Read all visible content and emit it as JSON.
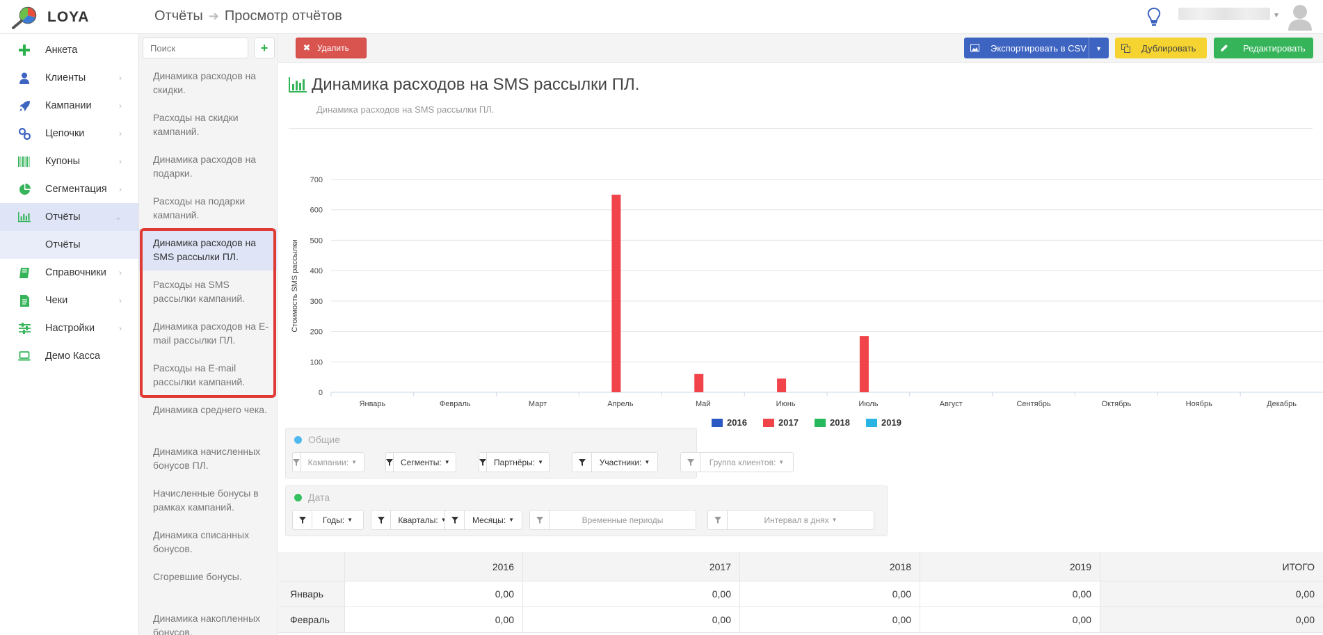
{
  "app": {
    "name": "LOYA"
  },
  "breadcrumb": {
    "root": "Отчёты",
    "current": "Просмотр отчётов"
  },
  "sidebar": {
    "items": [
      {
        "label": "Анкета",
        "icon": "plus-icon",
        "chevron": false
      },
      {
        "label": "Клиенты",
        "icon": "user-icon",
        "chevron": true
      },
      {
        "label": "Кампании",
        "icon": "rocket-icon",
        "chevron": true
      },
      {
        "label": "Цепочки",
        "icon": "link-icon",
        "chevron": true
      },
      {
        "label": "Купоны",
        "icon": "barcode-icon",
        "chevron": true
      },
      {
        "label": "Сегментация",
        "icon": "pie-chart-icon",
        "chevron": true
      },
      {
        "label": "Отчёты",
        "icon": "bar-chart-icon",
        "chevron": true,
        "active": true
      },
      {
        "label": "Справочники",
        "icon": "book-icon",
        "chevron": true
      },
      {
        "label": "Чеки",
        "icon": "receipt-icon",
        "chevron": true
      },
      {
        "label": "Настройки",
        "icon": "sliders-icon",
        "chevron": true
      },
      {
        "label": "Демо Касса",
        "icon": "laptop-icon",
        "chevron": false
      }
    ],
    "sub_item": "Отчёты"
  },
  "list": {
    "search_placeholder": "Поиск",
    "add_label": "+",
    "reports": [
      "Динамика расходов на скидки.",
      "Расходы на скидки кампаний.",
      "Динамика расходов на подарки.",
      "Расходы на подарки кампаний.",
      "Динамика расходов на SMS рассылки ПЛ.",
      "Расходы на SMS рассылки кампаний.",
      "Динамика расходов на E-mail рассылки ПЛ.",
      "Расходы на E-mail рассылки кампаний.",
      "Динамика среднего чека.",
      "Динамика начисленных бонусов ПЛ.",
      "Начисленные бонусы в рамках кампаний.",
      "Динамика списанных бонусов.",
      "Сгоревшие бонусы.",
      "Динамика накопленных бонусов."
    ],
    "selected_index": 4
  },
  "toolbar": {
    "delete_label": "Удалить",
    "export_label": "Экспортировать в CSV",
    "duplicate_label": "Дублировать",
    "edit_label": "Редактировать"
  },
  "report": {
    "title": "Динамика расходов на SMS рассылки ПЛ.",
    "subtitle": "Динамика расходов на SMS рассылки ПЛ."
  },
  "chart_data": {
    "type": "bar",
    "ylabel": "Стоимость SMS рассылки",
    "ylim": [
      0,
      700
    ],
    "yticks": [
      0,
      100,
      200,
      300,
      400,
      500,
      600,
      700
    ],
    "categories": [
      "Январь",
      "Февраль",
      "Март",
      "Апрель",
      "Май",
      "Июнь",
      "Июль",
      "Август",
      "Сентябрь",
      "Октябрь",
      "Ноябрь",
      "Декабрь"
    ],
    "series": [
      {
        "name": "2016",
        "color": "#2b59c3",
        "values": [
          0,
          0,
          0,
          0,
          0,
          0,
          0,
          0,
          0,
          0,
          0,
          0
        ]
      },
      {
        "name": "2017",
        "color": "#f0444a",
        "values": [
          0,
          0,
          0,
          650,
          60,
          45,
          185,
          0,
          0,
          0,
          0,
          0
        ]
      },
      {
        "name": "2018",
        "color": "#25b85c",
        "values": [
          0,
          0,
          0,
          0,
          0,
          0,
          0,
          0,
          0,
          0,
          0,
          0
        ]
      },
      {
        "name": "2019",
        "color": "#2ab4e3",
        "values": [
          0,
          0,
          0,
          0,
          0,
          0,
          0,
          0,
          0,
          0,
          0,
          0
        ]
      }
    ],
    "legend": "bottom",
    "grid": true
  },
  "filters": {
    "general": {
      "title": "Общие",
      "dot_color": "#4fb9ef",
      "items": [
        {
          "label": "Кампании:",
          "dim": true
        },
        {
          "label": "Сегменты:",
          "dim": false
        },
        {
          "label": "Партнёры:",
          "dim": false
        },
        {
          "label": "Участники:",
          "dim": false
        },
        {
          "label": "Группа клиентов:",
          "dim": true
        }
      ]
    },
    "date": {
      "title": "Дата",
      "dot_color": "#35c160",
      "items": [
        {
          "label": "Годы:",
          "dim": false
        },
        {
          "label": "Кварталы:",
          "dim": false
        },
        {
          "label": "Месяцы:",
          "dim": false
        },
        {
          "label": "Временные периоды",
          "dim": true,
          "nocaret": true
        },
        {
          "label": "Интервал в днях",
          "dim": true
        }
      ]
    }
  },
  "table": {
    "headers": [
      "",
      "2016",
      "2017",
      "2018",
      "2019",
      "ИТОГО"
    ],
    "rows": [
      {
        "label": "Январь",
        "values": [
          "0,00",
          "0,00",
          "0,00",
          "0,00",
          "0,00"
        ]
      },
      {
        "label": "Февраль",
        "values": [
          "0,00",
          "0,00",
          "0,00",
          "0,00",
          "0,00"
        ]
      }
    ]
  }
}
